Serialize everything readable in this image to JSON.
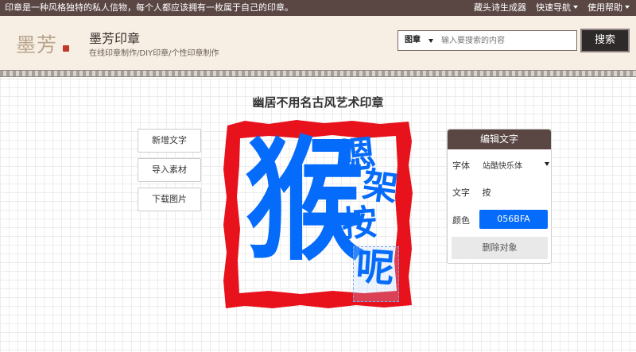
{
  "topbar": {
    "slogan": "印章是一种风格独特的私人信物，每个人都应该拥有一枚属于自己的印章。",
    "links": [
      "藏头诗生成器",
      "快速导航",
      "使用帮助"
    ]
  },
  "header": {
    "logo": "墨芳",
    "title": "墨芳印章",
    "subtitle": "在线印章制作/DIY印章/个性印章制作",
    "search_scope": "图章",
    "search_placeholder": "输入要搜索的内容",
    "search_button": "搜索"
  },
  "main": {
    "title": "幽居不用名古风艺术印章",
    "tools": [
      "新增文字",
      "导入素材",
      "下载图片"
    ],
    "seal": {
      "main_char": "猴",
      "side_chars": [
        "嗯",
        "架",
        "按",
        "呢"
      ],
      "text_color": "#056bfa",
      "border_color": "#e8121c"
    }
  },
  "editor": {
    "header": "编辑文字",
    "font_label": "字体",
    "font_value": "站酷快乐体",
    "text_label": "文字",
    "text_value": "按",
    "color_label": "颜色",
    "color_value": "056BFA",
    "delete_button": "删除对象"
  }
}
